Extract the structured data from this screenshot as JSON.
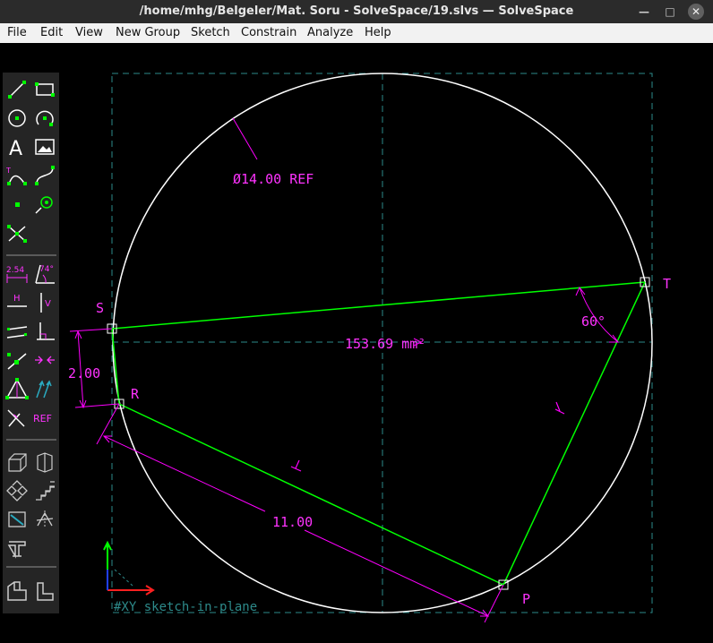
{
  "window": {
    "title": "/home/mhg/Belgeler/Mat. Soru - SolveSpace/19.slvs — SolveSpace",
    "buttons": [
      "minimize",
      "maximize",
      "close"
    ]
  },
  "menu": [
    "File",
    "Edit",
    "View",
    "New Group",
    "Sketch",
    "Constrain",
    "Analyze",
    "Help"
  ],
  "toolbar": {
    "groups": [
      [
        "line-segment-icon",
        "rectangle-icon",
        "circle-icon",
        "arc-icon",
        "text-icon",
        "image-icon",
        "tangent-arc-icon",
        "spline-icon",
        "point-icon",
        "construction-icon",
        "split-curves-icon"
      ],
      [
        "distance-constraint-icon",
        "angle-constraint-icon",
        "horizontal-constraint-icon",
        "vertical-constraint-icon",
        "parallel-constraint-icon",
        "perpendicular-constraint-icon",
        "point-on-line-icon",
        "midpoint-icon",
        "symmetric-constraint-icon",
        "same-orientation-icon",
        "other-angle-icon",
        "reference-toggle-icon"
      ],
      [
        "workplane-icon",
        "nearest-view-icon",
        "step-translate-icon",
        "step-rotate-icon",
        "extrude-icon",
        "lathe-icon",
        "revolve-icon"
      ],
      [
        "assemble-icon",
        "link-icon"
      ]
    ],
    "text_labels": {
      "distance": "2.54",
      "angle": "74°",
      "horizontal": "H",
      "vertical": "V",
      "reference": "REF",
      "text_tool": "A",
      "tangent_t": "T"
    }
  },
  "sketch": {
    "points": [
      "S",
      "R",
      "P",
      "T"
    ],
    "constraints": {
      "diameter": "Ø14.00 REF",
      "area": "153.69 mm²",
      "angle": "60°",
      "distance_sr": "2.00",
      "length_rp": "11.00"
    },
    "workplane_label": "#XY  sketch-in-plane"
  },
  "colors": {
    "background": "#000000",
    "construction": "#00ff00",
    "constraint": "#ff00ff",
    "circle": "#ffffff",
    "workplane": "#2d8a8a"
  }
}
